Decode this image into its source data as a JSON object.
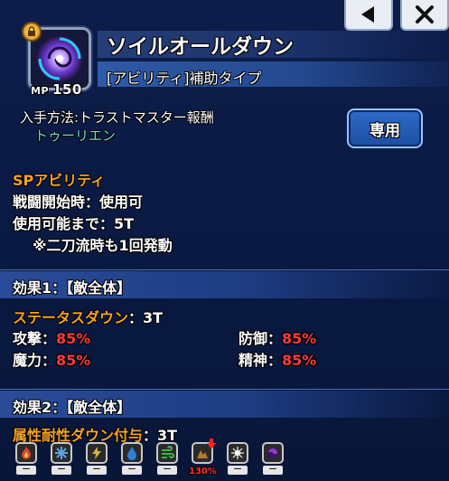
{
  "ability": {
    "name": "ソイルオールダウン",
    "type": "[アビリティ]補助タイプ",
    "mp_label": "MP",
    "mp_value": "150"
  },
  "acquisition": {
    "method": "入手方法:トラストマスター報酬",
    "character": "トゥーリエン",
    "exclusive_label": "専用"
  },
  "sp": {
    "heading": "SPアビリティ",
    "line1": "戦闘開始時：使用可",
    "line2": "使用可能まで：5T",
    "line3": "※二刀流時も1回発動"
  },
  "effect1": {
    "header": "効果1：【敵全体】",
    "name": "ステータスダウン",
    "turns": "：3T",
    "stats": [
      {
        "label": "攻撃：",
        "value": "85%"
      },
      {
        "label": "防御：",
        "value": "85%"
      },
      {
        "label": "魔力：",
        "value": "85%"
      },
      {
        "label": "精神：",
        "value": "85%"
      }
    ]
  },
  "effect2": {
    "header": "効果2：【敵全体】",
    "name": "属性耐性ダウン付与",
    "turns": "：3T",
    "elements": [
      {
        "icon": "fire-icon",
        "value": "ー",
        "color": "#e0432a"
      },
      {
        "icon": "ice-icon",
        "value": "ー",
        "color": "#5aa6e6"
      },
      {
        "icon": "lightning-icon",
        "value": "ー",
        "color": "#d4b43a"
      },
      {
        "icon": "water-icon",
        "value": "ー",
        "color": "#2e7fd6"
      },
      {
        "icon": "wind-icon",
        "value": "ー",
        "color": "#39b54a"
      },
      {
        "icon": "earth-icon",
        "value": "",
        "color": "#b07b2e",
        "down": "130%"
      },
      {
        "icon": "light-icon",
        "value": "ー",
        "color": "#cfcfcf"
      },
      {
        "icon": "dark-icon",
        "value": "ー",
        "color": "#8d3fd0"
      }
    ]
  }
}
